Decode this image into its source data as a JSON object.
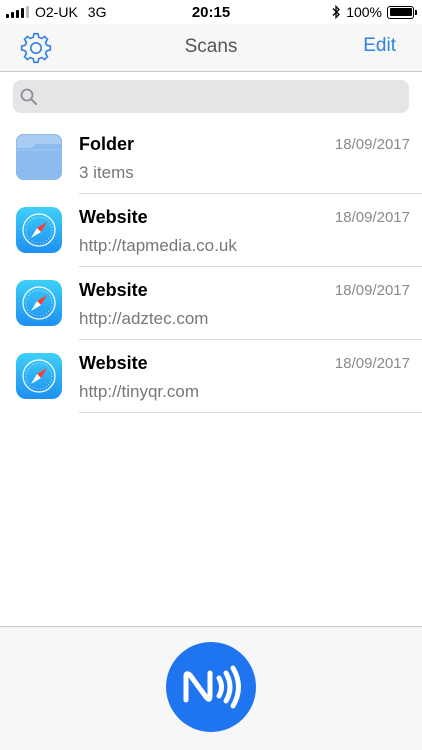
{
  "status_bar": {
    "carrier": "O2-UK",
    "network": "3G",
    "time": "20:15",
    "battery": "100%"
  },
  "nav": {
    "title": "Scans",
    "edit_label": "Edit"
  },
  "search": {
    "placeholder": "",
    "value": ""
  },
  "items": [
    {
      "title": "Folder",
      "subtitle": "3 items",
      "date": "18/09/2017",
      "icon": "folder-icon"
    },
    {
      "title": "Website",
      "subtitle": "http://tapmedia.co.uk",
      "date": "18/09/2017",
      "icon": "safari-icon"
    },
    {
      "title": "Website",
      "subtitle": "http://adztec.com",
      "date": "18/09/2017",
      "icon": "safari-icon"
    },
    {
      "title": "Website",
      "subtitle": "http://tinyqr.com",
      "date": "18/09/2017",
      "icon": "safari-icon"
    }
  ],
  "colors": {
    "accent": "#2f82e0",
    "nfc_button": "#1f74f0"
  }
}
